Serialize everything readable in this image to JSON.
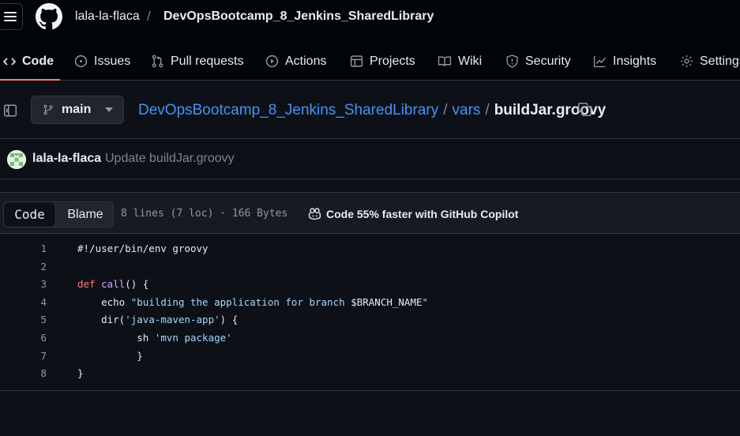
{
  "header": {
    "owner": "lala-la-flaca",
    "separator": "/",
    "repo": "DevOpsBootcamp_8_Jenkins_SharedLibrary",
    "tabs": [
      {
        "label": "Code",
        "icon": "code-icon",
        "active": true
      },
      {
        "label": "Issues",
        "icon": "issue-icon"
      },
      {
        "label": "Pull requests",
        "icon": "pull-request-icon"
      },
      {
        "label": "Actions",
        "icon": "play-icon"
      },
      {
        "label": "Projects",
        "icon": "table-icon"
      },
      {
        "label": "Wiki",
        "icon": "book-icon"
      },
      {
        "label": "Security",
        "icon": "shield-icon"
      },
      {
        "label": "Insights",
        "icon": "graph-icon"
      },
      {
        "label": "Settings",
        "icon": "gear-icon"
      }
    ]
  },
  "breadcrumb": {
    "branch": "main",
    "repo_link": "DevOpsBootcamp_8_Jenkins_SharedLibrary",
    "sep": "/",
    "folder": "vars",
    "file": "buildJar.groovy"
  },
  "commit": {
    "author": "lala-la-flaca",
    "message": "Update buildJar.groovy"
  },
  "file": {
    "view_code": "Code",
    "view_blame": "Blame",
    "meta": "8 lines (7 loc) · 166 Bytes",
    "copilot": "Code 55% faster with GitHub Copilot"
  },
  "code_lines": [
    {
      "n": "1",
      "parts": [
        {
          "t": "#!/user/bin/env groovy",
          "c": ""
        }
      ]
    },
    {
      "n": "2",
      "parts": []
    },
    {
      "n": "3",
      "parts": [
        {
          "t": "def",
          "c": "kw"
        },
        {
          "t": " ",
          "c": ""
        },
        {
          "t": "call",
          "c": "fn"
        },
        {
          "t": "() {",
          "c": ""
        }
      ]
    },
    {
      "n": "4",
      "parts": [
        {
          "t": "    echo ",
          "c": ""
        },
        {
          "t": "\"building the application for branch ",
          "c": "str"
        },
        {
          "t": "$BRANCH_NAME",
          "c": ""
        },
        {
          "t": "\"",
          "c": "str"
        }
      ]
    },
    {
      "n": "5",
      "parts": [
        {
          "t": "    dir(",
          "c": ""
        },
        {
          "t": "'java-maven-app'",
          "c": "str"
        },
        {
          "t": ") {",
          "c": ""
        }
      ]
    },
    {
      "n": "6",
      "parts": [
        {
          "t": "          sh ",
          "c": ""
        },
        {
          "t": "'mvn package'",
          "c": "str"
        }
      ]
    },
    {
      "n": "7",
      "parts": [
        {
          "t": "          }",
          "c": ""
        }
      ]
    },
    {
      "n": "8",
      "parts": [
        {
          "t": "}",
          "c": ""
        }
      ]
    }
  ]
}
